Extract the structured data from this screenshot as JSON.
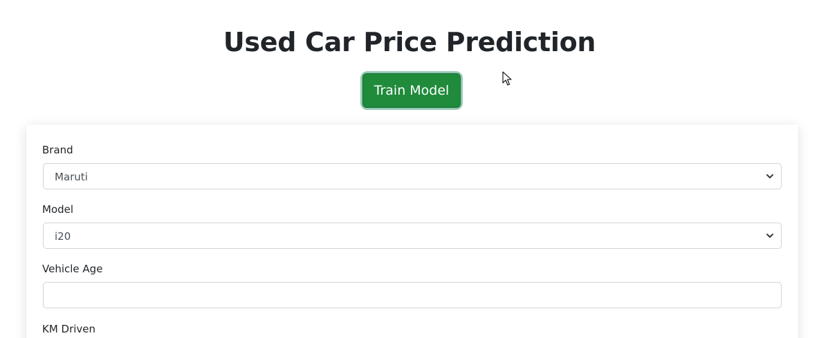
{
  "page": {
    "title": "Used Car Price Prediction",
    "train_button_label": "Train Model"
  },
  "form": {
    "brand": {
      "label": "Brand",
      "selected": "Maruti"
    },
    "model": {
      "label": "Model",
      "selected": "i20"
    },
    "vehicle_age": {
      "label": "Vehicle Age",
      "value": "",
      "placeholder": ""
    },
    "km_driven": {
      "label": "KM Driven"
    }
  },
  "colors": {
    "accent_button": "#1f8b3b",
    "card_background": "#ffffff",
    "border": "#ced4da"
  },
  "icons": {
    "select_arrow": "chevron-down-icon",
    "cursor": "mouse-pointer-icon"
  }
}
